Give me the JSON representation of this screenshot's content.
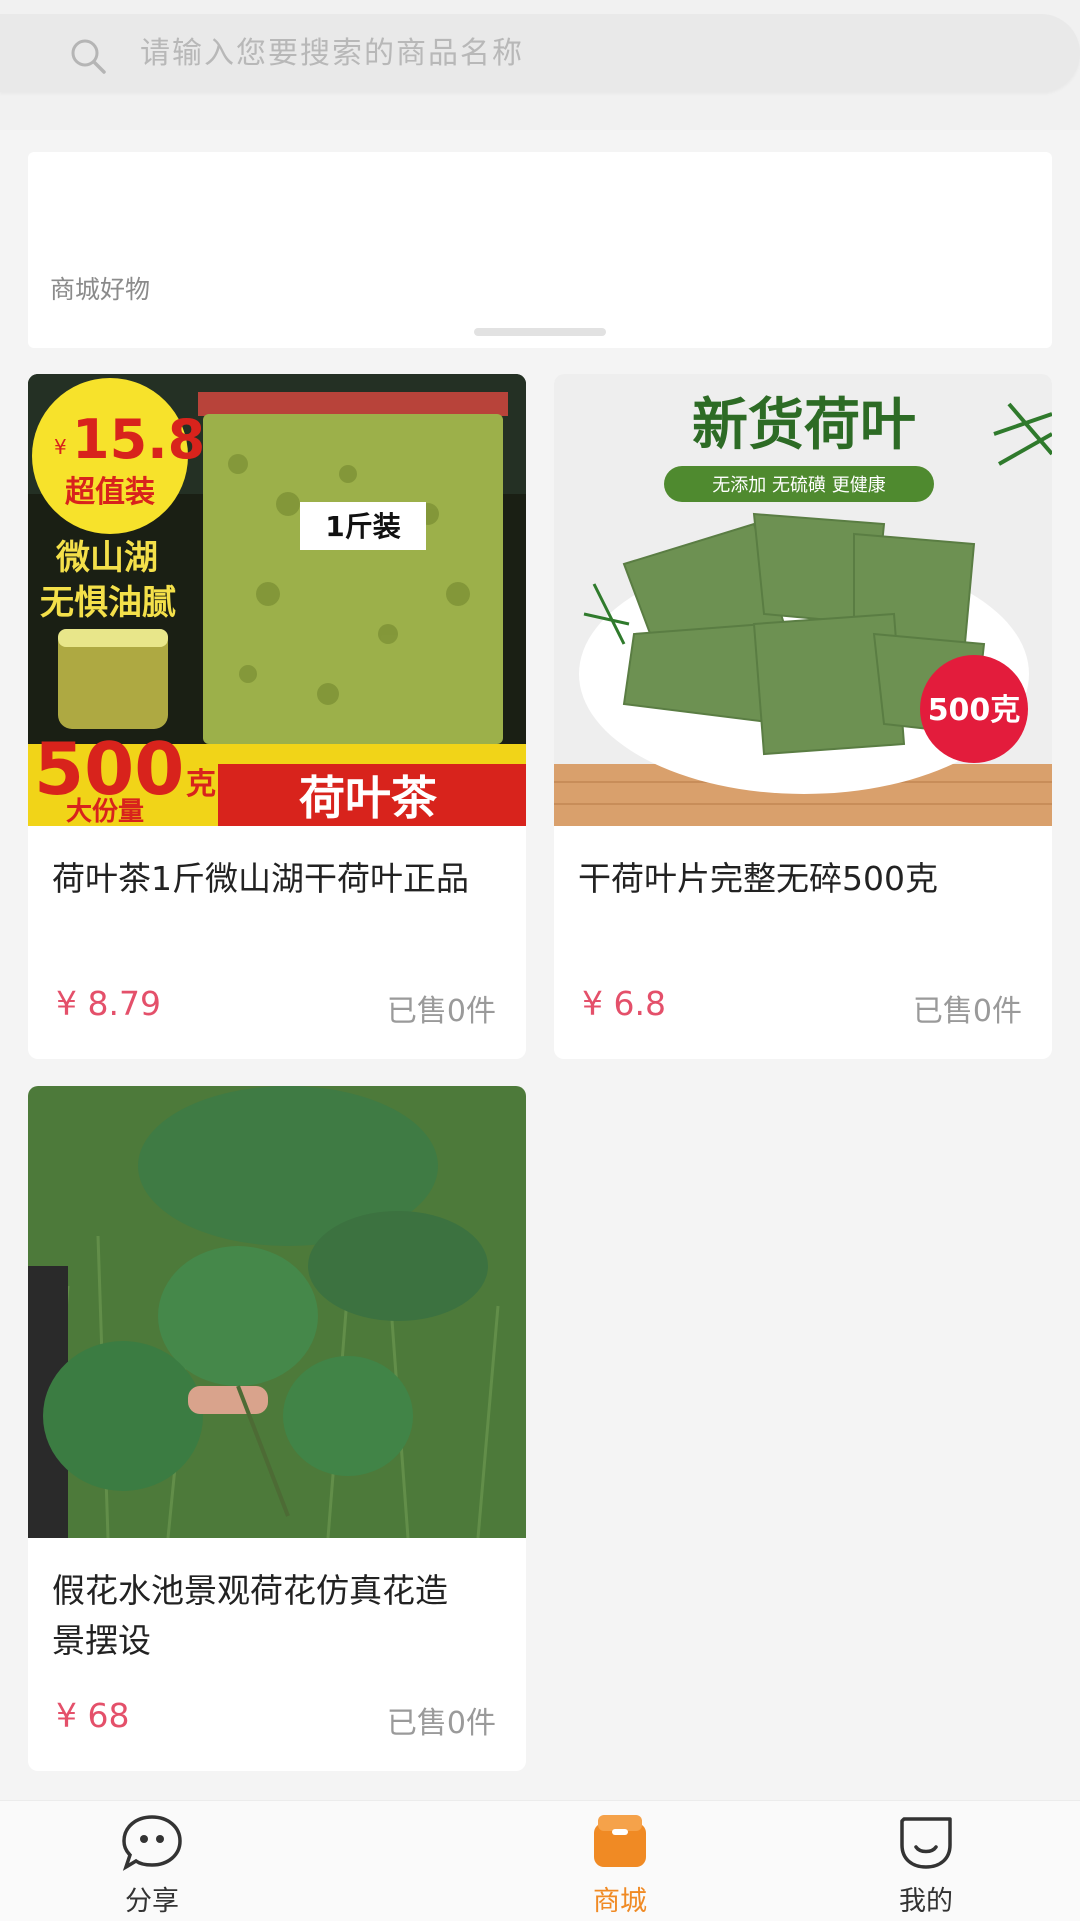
{
  "search": {
    "placeholder": "请输入您要搜索的商品名称"
  },
  "section": {
    "title": "商城好物"
  },
  "products": [
    {
      "title": "荷叶茶1斤微山湖干荷叶正品",
      "price": "¥ 8.79",
      "sold": "已售0件",
      "image_text": {
        "badge_price": "15.8",
        "badge_yen": "¥",
        "badge_label": "超值装",
        "origin_1": "微山湖",
        "origin_2": "无惧油腻",
        "bag_label": "1斤装",
        "weight": "500",
        "weight_unit": "克",
        "size_label": "大份量",
        "product_name": "荷叶茶"
      }
    },
    {
      "title": "干荷叶片完整无碎500克",
      "price": "¥ 6.8",
      "sold": "已售0件",
      "image_text": {
        "headline": "新货荷叶",
        "tagline": "无添加 无硫磺 更健康",
        "weight_badge": "500克"
      }
    },
    {
      "title": "假花水池景观荷花仿真花造景摆设",
      "price": "¥ 68",
      "sold": "已售0件"
    }
  ],
  "tabbar": {
    "items": [
      {
        "label": "分享",
        "icon": "chat-bubble-face-icon"
      },
      {
        "label": "商城",
        "icon": "shopping-bag-icon"
      },
      {
        "label": "我的",
        "icon": "smile-face-icon"
      }
    ],
    "active_color": "#f08a24"
  },
  "colors": {
    "price": "#e4506a",
    "background": "#f4f4f4"
  }
}
